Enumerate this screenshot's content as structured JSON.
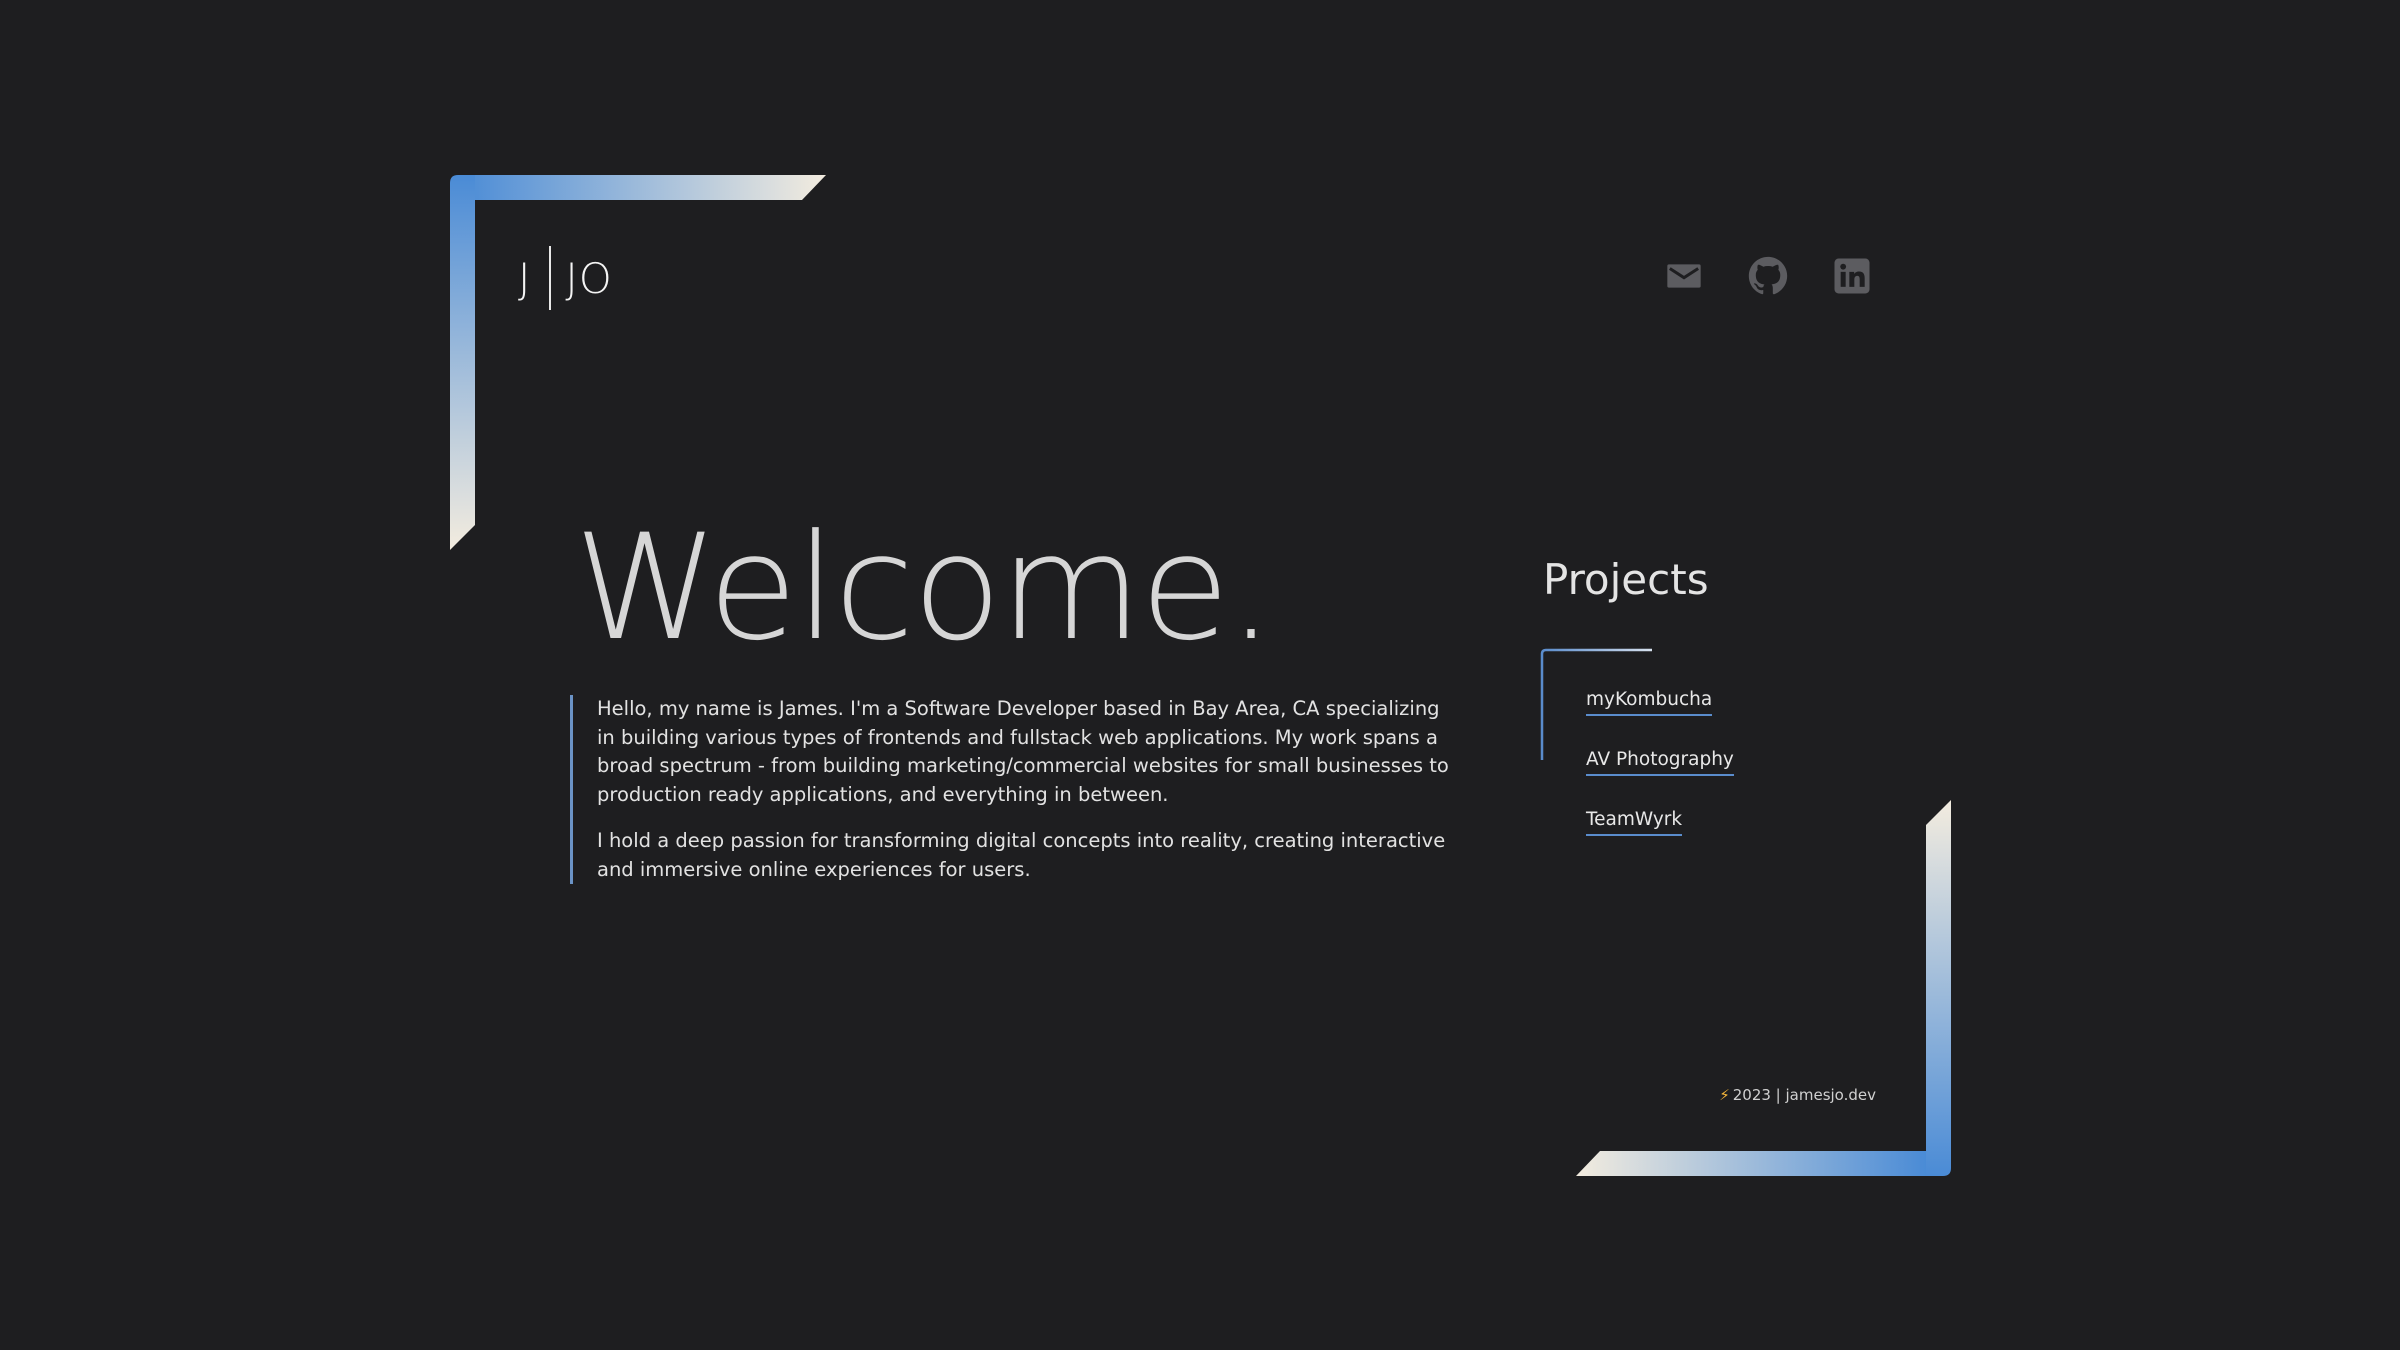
{
  "logo": {
    "left": "J",
    "right": "JO"
  },
  "socials": [
    {
      "icon": "mail-icon",
      "label": "Email"
    },
    {
      "icon": "github-icon",
      "label": "GitHub"
    },
    {
      "icon": "linkedin-icon",
      "label": "LinkedIn"
    }
  ],
  "hero": {
    "title": "Welcome.",
    "paragraphs": [
      "Hello, my name is James. I'm a Software Developer based in Bay Area, CA specializing in building various types of frontends and fullstack web applications. My work spans a broad spectrum - from building marketing/commercial websites for small businesses to production ready applications, and everything in between.",
      "I hold a deep passion for transforming digital concepts into reality, creating interactive and immersive online experiences for users."
    ]
  },
  "projects": {
    "title": "Projects",
    "items": [
      "myKombucha",
      "AV Photography",
      "TeamWyrk"
    ]
  },
  "footer": {
    "icon": "lightning-bolt-icon",
    "text": "2023 | jamesjo.dev"
  },
  "colors": {
    "background": "#1e1e20",
    "gradient_blue": "#4a8bd6",
    "gradient_cream": "#f3ecdf",
    "accent_line": "#6b93c6",
    "icon_gray": "#5c5c60",
    "bolt": "#f2b43a"
  }
}
